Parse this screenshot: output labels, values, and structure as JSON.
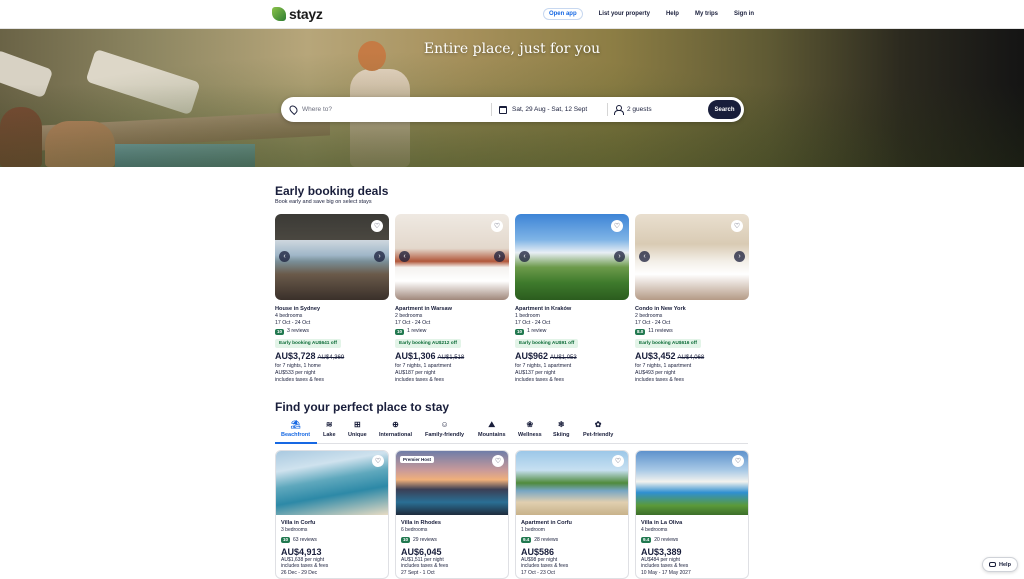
{
  "header": {
    "brand": "stayz",
    "nav": [
      "Open app",
      "List your property",
      "Help",
      "My trips",
      "Sign in"
    ]
  },
  "hero": {
    "title": "Entire place, just for you",
    "search": {
      "where_placeholder": "Where to?",
      "dates": "Sat, 29 Aug - Sat, 12 Sept",
      "guests": "2 guests",
      "button": "Search"
    }
  },
  "early": {
    "title": "Early booking deals",
    "subtitle": "Book early and save big on select stays",
    "cards": [
      {
        "type": "House in Sydney",
        "beds": "4 bedrooms",
        "dates": "17 Oct - 24 Oct",
        "score": "10",
        "reviews": "3 reviews",
        "deal": "Early booking AU$641 off",
        "price": "AU$3,728",
        "old": "AU$4,369",
        "l1": "for 7 nights, 1 home",
        "l2": "AU$533 per night",
        "l3": "includes taxes & fees"
      },
      {
        "type": "Apartment in Warsaw",
        "beds": "2 bedrooms",
        "dates": "17 Oct - 24 Oct",
        "score": "10",
        "reviews": "1 review",
        "deal": "Early booking AU$212 off",
        "price": "AU$1,306",
        "old": "AU$1,518",
        "l1": "for 7 nights, 1 apartment",
        "l2": "AU$187 per night",
        "l3": "includes taxes & fees"
      },
      {
        "type": "Apartment in Kraków",
        "beds": "1 bedroom",
        "dates": "17 Oct - 24 Oct",
        "score": "10",
        "reviews": "1 review",
        "deal": "Early booking AU$91 off",
        "price": "AU$962",
        "old": "AU$1,053",
        "l1": "for 7 nights, 1 apartment",
        "l2": "AU$137 per night",
        "l3": "includes taxes & fees"
      },
      {
        "type": "Condo in New York",
        "beds": "2 bedrooms",
        "dates": "17 Oct - 24 Oct",
        "score": "8.0",
        "reviews": "11 reviews",
        "deal": "Early booking AU$616 off",
        "price": "AU$3,452",
        "old": "AU$4,068",
        "l1": "for 7 nights, 1 apartment",
        "l2": "AU$493 per night",
        "l3": "includes taxes & fees"
      }
    ]
  },
  "find": {
    "title": "Find your perfect place to stay",
    "tabs": [
      {
        "label": "Beachfront",
        "icon": "⛱"
      },
      {
        "label": "Lake",
        "icon": "≋"
      },
      {
        "label": "Unique",
        "icon": "⊞"
      },
      {
        "label": "International",
        "icon": "⊕"
      },
      {
        "label": "Family-friendly",
        "icon": "☺"
      },
      {
        "label": "Mountains",
        "icon": "⛰"
      },
      {
        "label": "Wellness",
        "icon": "❀"
      },
      {
        "label": "Skiing",
        "icon": "❄"
      },
      {
        "label": "Pet-friendly",
        "icon": "✿"
      }
    ],
    "cards": [
      {
        "type": "Villa in Corfu",
        "beds": "3 bedrooms",
        "score": "10",
        "reviews": "63 reviews",
        "price": "AU$4,913",
        "l1": "AU$1,638 per night",
        "l2": "includes taxes & fees",
        "l3": "26 Dec - 29 Dec"
      },
      {
        "type": "Villa in Rhodes",
        "beds": "6 bedrooms",
        "score": "10",
        "reviews": "29 reviews",
        "price": "AU$6,045",
        "l1": "AU$1,511 per night",
        "l2": "includes taxes & fees",
        "l3": "27 Sept - 1 Oct",
        "premier": "Premier Host"
      },
      {
        "type": "Apartment in Corfu",
        "beds": "1 bedroom",
        "score": "9.4",
        "reviews": "28 reviews",
        "price": "AU$586",
        "l1": "AU$98 per night",
        "l2": "includes taxes & fees",
        "l3": "17 Oct - 23 Oct"
      },
      {
        "type": "Villa in La Oliva",
        "beds": "4 bedrooms",
        "score": "9.4",
        "reviews": "20 reviews",
        "price": "AU$3,389",
        "l1": "AU$484 per night",
        "l2": "includes taxes & fees",
        "l3": "10 May - 17 May 2027"
      }
    ]
  },
  "help": "Help"
}
